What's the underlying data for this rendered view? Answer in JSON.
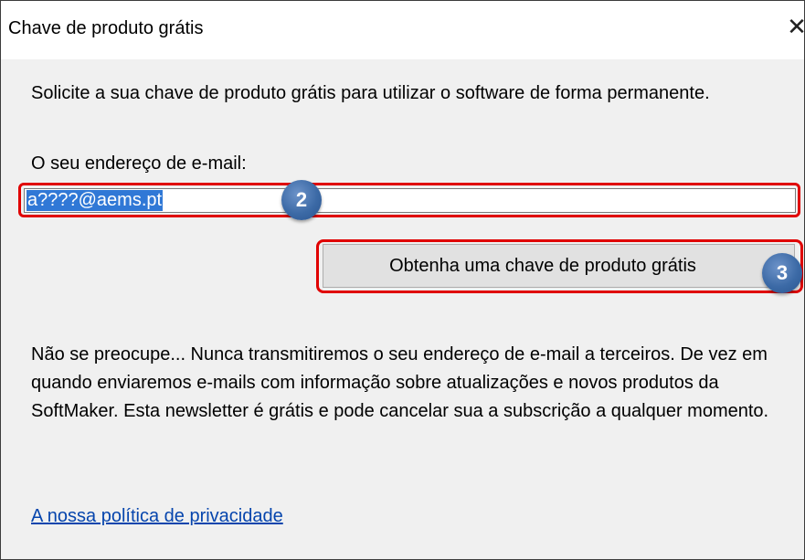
{
  "window": {
    "title": "Chave de produto grátis",
    "close_symbol": "✕"
  },
  "intro_text": "Solicite a sua chave de produto grátis para utilizar o software de forma permanente.",
  "email": {
    "label": "O seu endereço de e-mail:",
    "value": "a????@aems.pt",
    "selected": true
  },
  "submit_button_label": "Obtenha uma chave de produto grátis",
  "badges": {
    "email_step": "2",
    "button_step": "3"
  },
  "notice_text": "Não se preocupe... Nunca transmitiremos o seu endereço de e-mail a terceiros. De vez em quando enviaremos e-mails com informação sobre atualizações e novos produtos da SoftMaker. Esta newsletter é grátis e pode cancelar sua a subscrição a qualquer momento.",
  "privacy_link": "A nossa política de privacidade",
  "colors": {
    "highlight_outline": "#e00000",
    "selection": "#3078d6",
    "badge": "#3c6aa6",
    "link": "#0645ad"
  }
}
